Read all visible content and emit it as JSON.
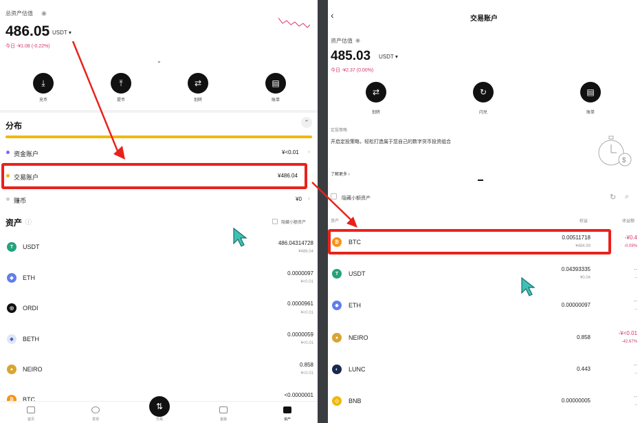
{
  "left": {
    "total_label": "总资产估值",
    "total_value": "486.05",
    "total_unit": "USDT",
    "today": "今日 -¥1.08 (-0.22%)",
    "actions": [
      {
        "label": "充币",
        "icon": "download-icon"
      },
      {
        "label": "提币",
        "icon": "upload-icon"
      },
      {
        "label": "划转",
        "icon": "transfer-icon"
      },
      {
        "label": "账单",
        "icon": "bill-icon"
      }
    ],
    "section_distribution": "分布",
    "accounts": [
      {
        "label": "资金账户",
        "value": "¥<0.01",
        "color": "#7a6cf0"
      },
      {
        "label": "交易账户",
        "value": "¥486.04",
        "color": "#f0b90b"
      },
      {
        "label": "赚币",
        "value": "¥0",
        "color": "#cccccc"
      }
    ],
    "section_assets": "资产",
    "hide_small": "隐藏小额资产",
    "assets": [
      {
        "name": "USDT",
        "amount": "486.04314728",
        "sub": "¥486.04",
        "color": "#26a17b",
        "glyph": "T"
      },
      {
        "name": "ETH",
        "amount": "0.0000097",
        "sub": "¥<0.01",
        "color": "#627eea",
        "glyph": "◆"
      },
      {
        "name": "ORDI",
        "amount": "0.0000961",
        "sub": "¥<0.01",
        "color": "#111111",
        "glyph": "◎"
      },
      {
        "name": "BETH",
        "amount": "0.0000059",
        "sub": "¥<0.01",
        "color": "#dfe6f7",
        "glyph": "◆"
      },
      {
        "name": "NEIRO",
        "amount": "0.858",
        "sub": "¥<0.01",
        "color": "#d8a531",
        "glyph": "●"
      },
      {
        "name": "BTC",
        "amount": "<0.0000001",
        "sub": "",
        "color": "#f7931a",
        "glyph": "₿"
      }
    ],
    "tabs": [
      {
        "label": "首页"
      },
      {
        "label": "发现"
      },
      {
        "label": "交易"
      },
      {
        "label": "金融"
      },
      {
        "label": "资产"
      }
    ]
  },
  "right": {
    "title": "交易账户",
    "total_label": "资产估值",
    "total_value": "485.03",
    "total_unit": "USDT",
    "today": "今日 -¥2.37 (0.00%)",
    "actions": [
      {
        "label": "划转",
        "icon": "transfer-icon"
      },
      {
        "label": "闪兑",
        "icon": "flash-icon"
      },
      {
        "label": "账单",
        "icon": "bill-icon"
      }
    ],
    "promo_title": "定投策略",
    "promo_text": "开启定投策略，轻松打造属于您自己的数字货币投资组合",
    "promo_more": "了解更多",
    "hide_small": "隐藏小额资产",
    "col_asset": "资产",
    "col_equity": "权益",
    "col_pnl": "收益额",
    "assets": [
      {
        "name": "BTC",
        "amount": "0.00511718",
        "sub": "¥484.99",
        "pnl": "-¥0.4",
        "pnl_pct": "-0.09%",
        "color": "#f7931a",
        "glyph": "₿"
      },
      {
        "name": "USDT",
        "amount": "0.04393335",
        "sub": "¥0.04",
        "pnl": "--",
        "pnl_pct": "--",
        "color": "#26a17b",
        "glyph": "T"
      },
      {
        "name": "ETH",
        "amount": "0.00000097",
        "sub": "",
        "pnl": "--",
        "pnl_pct": "--",
        "color": "#627eea",
        "glyph": "◆"
      },
      {
        "name": "NEIRO",
        "amount": "0.858",
        "sub": "",
        "pnl": "-¥<0.01",
        "pnl_pct": "-42.67%",
        "color": "#d8a531",
        "glyph": "●"
      },
      {
        "name": "LUNC",
        "amount": "0.443",
        "sub": "",
        "pnl": "--",
        "pnl_pct": "--",
        "color": "#172852",
        "glyph": "◐"
      },
      {
        "name": "BNB",
        "amount": "0.00000005",
        "sub": "",
        "pnl": "--",
        "pnl_pct": "--",
        "color": "#f0b90b",
        "glyph": "◇"
      }
    ]
  },
  "colors": {
    "highlight": "#e8221b",
    "negative": "#d6336c",
    "accent": "#f0b90b"
  }
}
